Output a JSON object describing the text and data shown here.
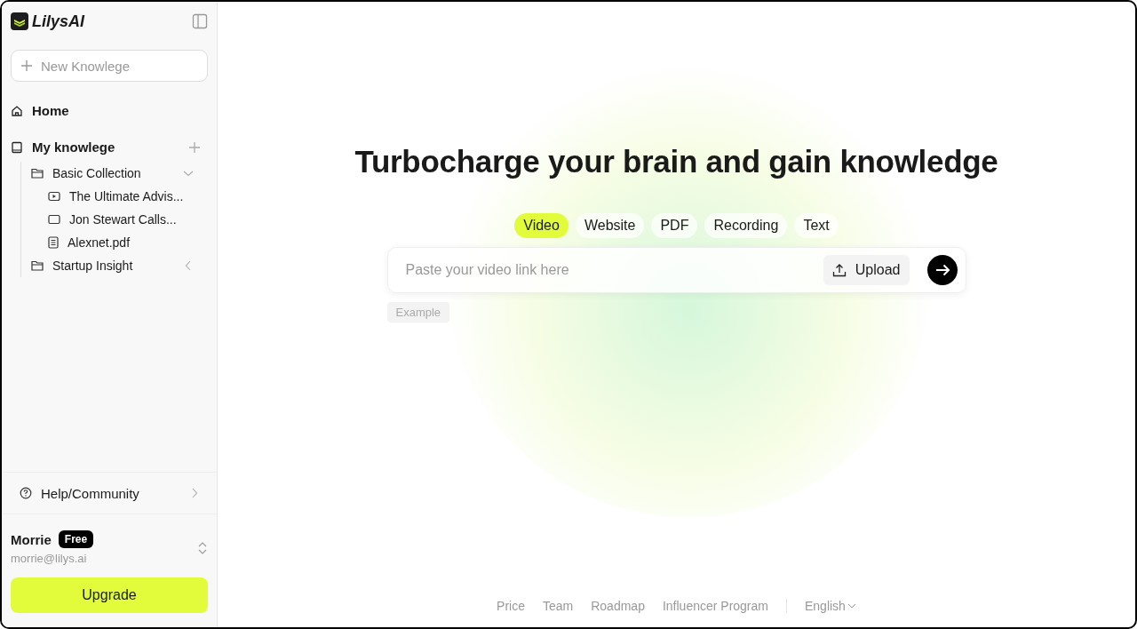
{
  "app": {
    "name": "LilysAI"
  },
  "sidebar": {
    "new_button": {
      "placeholder": "New Knowlege"
    },
    "home": "Home",
    "section": {
      "label": "My knowlege",
      "children": [
        {
          "label": "Basic Collection",
          "expanded": true,
          "children": [
            {
              "label": "The Ultimate Advis...",
              "kind": "video"
            },
            {
              "label": "Jon Stewart Calls...",
              "kind": "page"
            },
            {
              "label": "Alexnet.pdf",
              "kind": "document"
            }
          ]
        },
        {
          "label": "Startup Insight",
          "expanded": false
        }
      ]
    },
    "help": "Help/Community",
    "user": {
      "name": "Morrie",
      "plan": "Free",
      "email": "morrie@lilys.ai"
    },
    "upgrade": "Upgrade"
  },
  "main": {
    "headline": "Turbocharge your brain and gain knowledge",
    "tabs": [
      {
        "label": "Video",
        "selected": true
      },
      {
        "label": "Website",
        "selected": false
      },
      {
        "label": "PDF",
        "selected": false
      },
      {
        "label": "Recording",
        "selected": false
      },
      {
        "label": "Text",
        "selected": false
      }
    ],
    "input": {
      "placeholder": "Paste your video link here"
    },
    "upload": "Upload",
    "example": "Example"
  },
  "footer": {
    "links": [
      "Price",
      "Team",
      "Roadmap",
      "Influencer Program"
    ],
    "language": "English"
  }
}
